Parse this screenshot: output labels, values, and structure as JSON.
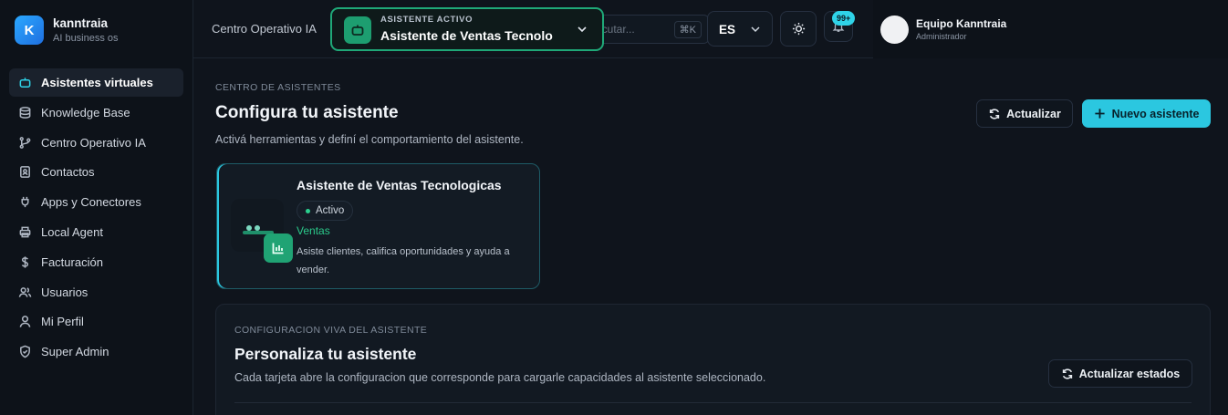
{
  "brand": {
    "name": "kanntraia",
    "subtitle": "AI business os",
    "logo_letter": "K"
  },
  "sidebar": {
    "items": [
      {
        "label": "Asistentes virtuales",
        "icon": "robot-icon",
        "active": true
      },
      {
        "label": "Knowledge Base",
        "icon": "database-icon"
      },
      {
        "label": "Centro Operativo IA",
        "icon": "git-branch-icon"
      },
      {
        "label": "Contactos",
        "icon": "contact-card-icon"
      },
      {
        "label": "Apps y Conectores",
        "icon": "plug-icon"
      },
      {
        "label": "Local Agent",
        "icon": "printer-icon"
      },
      {
        "label": "Facturación",
        "icon": "dollar-icon"
      },
      {
        "label": "Usuarios",
        "icon": "users-icon"
      },
      {
        "label": "Mi Perfil",
        "icon": "user-icon"
      },
      {
        "label": "Super Admin",
        "icon": "shield-icon"
      }
    ]
  },
  "header": {
    "title": "Centro Operativo IA",
    "assistant_kicker": "ASISTENTE ACTIVO",
    "assistant_name": "Asistente de Ventas Tecnolo",
    "search_placeholder": "ecutar...",
    "search_shortcut": "⌘K",
    "language": "ES",
    "notifications_badge": "99+"
  },
  "user": {
    "name": "Equipo Kanntraia",
    "role": "Administrador"
  },
  "main": {
    "kicker": "CENTRO DE ASISTENTES",
    "title": "Configura tu asistente",
    "subtitle": "Activá herramientas y definí el comportamiento del asistente.",
    "refresh_label": "Actualizar",
    "new_label": "Nuevo asistente"
  },
  "card": {
    "title": "Asistente de Ventas Tecnologicas",
    "status": "Activo",
    "category": "Ventas",
    "description": "Asiste clientes, califica oportunidades y ayuda a vender."
  },
  "panel": {
    "kicker": "CONFIGURACION VIVA DEL ASISTENTE",
    "title": "Personaliza tu asistente",
    "subtitle": "Cada tarjeta abre la configuracion que corresponde para cargarle capacidades al asistente seleccionado.",
    "refresh_label": "Actualizar estados"
  },
  "colors": {
    "accent": "#2bc7e0",
    "success": "#1fa878",
    "background": "#0f141c"
  }
}
